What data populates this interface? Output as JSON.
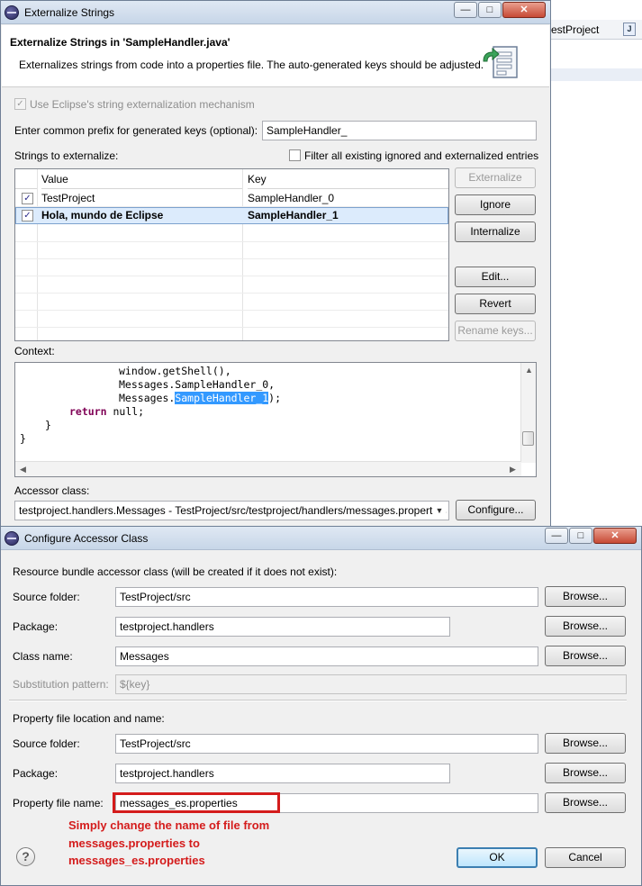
{
  "background": {
    "tab_label": "estProject",
    "tab_icon_letter": "J"
  },
  "externalize": {
    "title": "Externalize Strings",
    "controls": {
      "minimize": "—",
      "maximize": "□",
      "close": "✕"
    },
    "banner_title": "Externalize Strings in 'SampleHandler.java'",
    "banner_desc": "Externalizes strings from code into a properties file. The auto-generated keys should be adjusted.",
    "use_eclipse_label": "Use Eclipse's string externalization mechanism",
    "use_eclipse_checked": true,
    "prefix_label": "Enter common prefix for generated keys (optional):",
    "prefix_value": "SampleHandler_",
    "strings_label": "Strings to externalize:",
    "filter_label": "Filter all existing ignored and externalized entries",
    "filter_checked": false,
    "table": {
      "columns": [
        "Value",
        "Key"
      ],
      "rows": [
        {
          "checked": "✓",
          "value": "TestProject",
          "key": "SampleHandler_0"
        },
        {
          "checked": "✓",
          "value": "Hola, mundo de Eclipse",
          "key": "SampleHandler_1"
        }
      ]
    },
    "buttons": {
      "externalize": "Externalize",
      "ignore": "Ignore",
      "internalize": "Internalize",
      "edit": "Edit...",
      "revert": "Revert",
      "rename_keys": "Rename keys..."
    },
    "context_label": "Context:",
    "code": {
      "line1": "window.getShell(),",
      "line2": "Messages.SampleHandler_0,",
      "line3_prefix": "Messages.",
      "line3_highlight": "SampleHandler_1",
      "line3_suffix": ");",
      "line4_keyword": "return",
      "line4_rest": " null;",
      "line5": "}",
      "line6": "}"
    },
    "accessor_label": "Accessor class:",
    "accessor_value": "testproject.handlers.Messages - TestProject/src/testproject/handlers/messages.properties",
    "configure_button": "Configure..."
  },
  "configure": {
    "title": "Configure Accessor Class",
    "controls": {
      "minimize": "—",
      "maximize": "□",
      "close": "✕"
    },
    "section1": "Resource bundle accessor class (will be created if it does not exist):",
    "source_folder_label": "Source folder:",
    "source_folder_value": "TestProject/src",
    "package_label": "Package:",
    "package_value": "testproject.handlers",
    "class_name_label": "Class name:",
    "class_name_value": "Messages",
    "subst_label": "Substitution pattern:",
    "subst_value": "${key}",
    "section2": "Property file location and name:",
    "prop_source_folder_label": "Source folder:",
    "prop_source_folder_value": "TestProject/src",
    "prop_package_label": "Package:",
    "prop_package_value": "testproject.handlers",
    "prop_file_label": "Property file name:",
    "prop_file_value": "messages_es.properties",
    "browse": "Browse...",
    "annotation": "Simply change the name of file from messages.properties to messages_es.properties",
    "annotation_color": "#d41c1c",
    "help": "?",
    "ok": "OK",
    "cancel": "Cancel"
  }
}
